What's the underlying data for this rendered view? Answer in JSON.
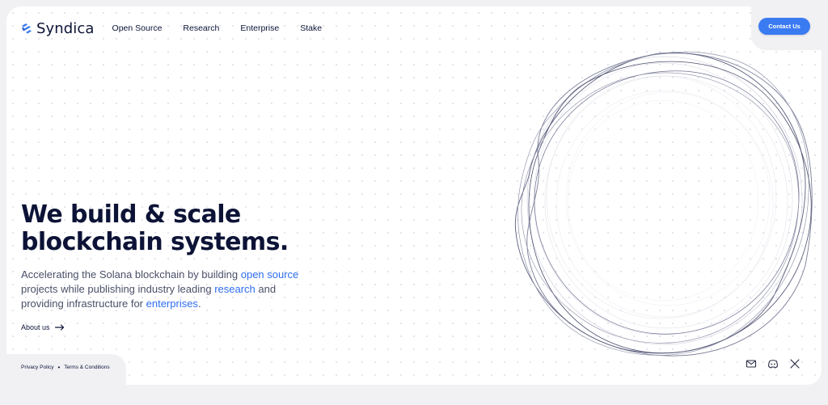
{
  "brand": {
    "name": "Syndica",
    "accent": "#3b7bf2",
    "text": "#0c1336"
  },
  "nav": {
    "items": [
      {
        "label": "Open Source"
      },
      {
        "label": "Research"
      },
      {
        "label": "Enterprise"
      },
      {
        "label": "Stake"
      }
    ]
  },
  "header": {
    "contact_label": "Contact Us"
  },
  "hero": {
    "title_line1": "We build & scale",
    "title_line2": "blockchain systems.",
    "sub_1": "Accelerating the Solana blockchain by building ",
    "link_open_source": "open source",
    "sub_2": " projects while publishing industry leading ",
    "link_research": "research",
    "sub_3": " and providing infrastructure for ",
    "link_enterprises": "enterprises",
    "sub_4": "."
  },
  "about": {
    "label": "About us"
  },
  "footer": {
    "privacy": "Privacy Policy",
    "separator": "•",
    "terms": "Terms & Conditions"
  },
  "socials": [
    {
      "icon": "mail-icon"
    },
    {
      "icon": "discord-icon"
    },
    {
      "icon": "x-icon"
    }
  ]
}
